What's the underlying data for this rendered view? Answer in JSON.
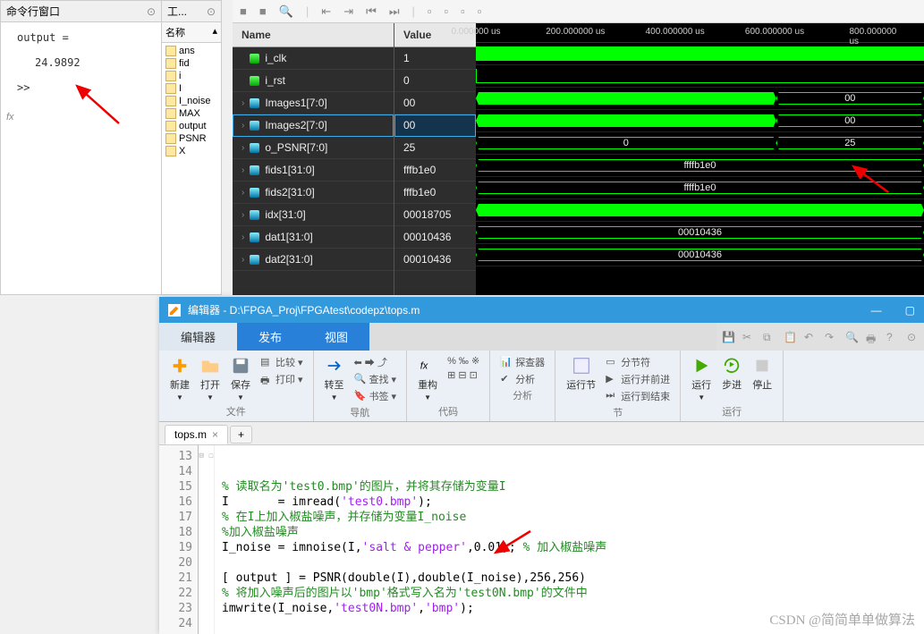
{
  "matlab_cmd": {
    "title": "命令行窗口",
    "output_label": "output =",
    "output_value": "24.9892",
    "prompt": ">>"
  },
  "workspace": {
    "header": "工...",
    "col": "名称",
    "vars": [
      "ans",
      "fid",
      "i",
      "I",
      "I_noise",
      "MAX",
      "output",
      "PSNR",
      "X"
    ]
  },
  "wave": {
    "name_hdr": "Name",
    "value_hdr": "Value",
    "ruler": [
      "0.000000 us",
      "200.000000 us",
      "400.000000 us",
      "600.000000 us",
      "800.000000 us"
    ],
    "signals": [
      {
        "name": "i_clk",
        "value": "1",
        "type": "bit",
        "icon": "green"
      },
      {
        "name": "i_rst",
        "value": "0",
        "type": "bit",
        "icon": "green"
      },
      {
        "name": "Images1[7:0]",
        "value": "00",
        "type": "bus",
        "icon": "cyan",
        "seg": [
          {
            "w": 67,
            "t": ""
          },
          {
            "w": 33,
            "t": "00"
          }
        ]
      },
      {
        "name": "Images2[7:0]",
        "value": "00",
        "type": "bus",
        "icon": "cyan",
        "sel": true,
        "seg": [
          {
            "w": 67,
            "t": ""
          },
          {
            "w": 33,
            "t": "00"
          }
        ]
      },
      {
        "name": "o_PSNR[7:0]",
        "value": "25",
        "type": "bus",
        "icon": "cyan",
        "seg": [
          {
            "w": 67,
            "t": "0"
          },
          {
            "w": 33,
            "t": "25"
          }
        ]
      },
      {
        "name": "fids1[31:0]",
        "value": "fffb1e0",
        "type": "bus",
        "icon": "cyan",
        "seg": [
          {
            "w": 100,
            "t": "ffffb1e0"
          }
        ]
      },
      {
        "name": "fids2[31:0]",
        "value": "fffb1e0",
        "type": "bus",
        "icon": "cyan",
        "seg": [
          {
            "w": 100,
            "t": "ffffb1e0"
          }
        ]
      },
      {
        "name": "idx[31:0]",
        "value": "00018705",
        "type": "bus",
        "icon": "cyan",
        "seg": [
          {
            "w": 100,
            "t": ""
          }
        ]
      },
      {
        "name": "dat1[31:0]",
        "value": "00010436",
        "type": "bus",
        "icon": "cyan",
        "seg": [
          {
            "w": 100,
            "t": "00010436"
          }
        ]
      },
      {
        "name": "dat2[31:0]",
        "value": "00010436",
        "type": "bus",
        "icon": "cyan",
        "seg": [
          {
            "w": 100,
            "t": "00010436"
          }
        ]
      }
    ]
  },
  "editor": {
    "title": "编辑器 - D:\\FPGA_Proj\\FPGAtest\\codepz\\tops.m",
    "tabs": {
      "editor": "编辑器",
      "publish": "发布",
      "view": "视图"
    },
    "ribbon": {
      "file": {
        "new": "新建",
        "open": "打开",
        "save": "保存",
        "compare": "比较",
        "print": "打印",
        "group": "文件"
      },
      "nav": {
        "goto": "转至",
        "find": "查找",
        "bookmark": "书签",
        "group": "导航"
      },
      "code": {
        "refactor": "重构",
        "group": "代码"
      },
      "analyze": {
        "explorer": "探查器",
        "analyze": "分析",
        "group": "分析"
      },
      "section": {
        "runsec": "运行节",
        "break": "分节符",
        "runadv": "运行并前进",
        "runend": "运行到结束",
        "group": "节"
      },
      "run": {
        "run": "运行",
        "step": "步进",
        "stop": "停止",
        "group": "运行"
      }
    },
    "file_tab": "tops.m",
    "code_lines": [
      {
        "n": 13,
        "t": ""
      },
      {
        "n": 14,
        "t": ""
      },
      {
        "n": 15,
        "t": "<cm>% 读取名为'test0.bmp'的图片，并将其存储为变量I</cm>"
      },
      {
        "n": 16,
        "t": "I       = imread(<str>'test0.bmp'</str>);"
      },
      {
        "n": 17,
        "t": "<cm>% 在I上加入椒盐噪声，并存储为变量I_noise</cm>"
      },
      {
        "n": 18,
        "t": "<cm>%加入椒盐噪声</cm>"
      },
      {
        "n": 19,
        "t": "I_noise = imnoise(I,<str>'salt & pepper'</str>,0.01); <cm>% 加入椒盐噪声</cm>"
      },
      {
        "n": 20,
        "t": ""
      },
      {
        "n": 21,
        "t": "[ output ] = PSNR(double(I),double(I_noise),256,256)"
      },
      {
        "n": 22,
        "t": "<cm>% 将加入噪声后的图片以'bmp'格式写入名为'test0N.bmp'的文件中</cm>"
      },
      {
        "n": 23,
        "t": "imwrite(I_noise,<str>'test0N.bmp'</str>,<str>'bmp'</str>);"
      },
      {
        "n": 24,
        "t": ""
      }
    ]
  },
  "watermark": "CSDN @简简单单做算法"
}
